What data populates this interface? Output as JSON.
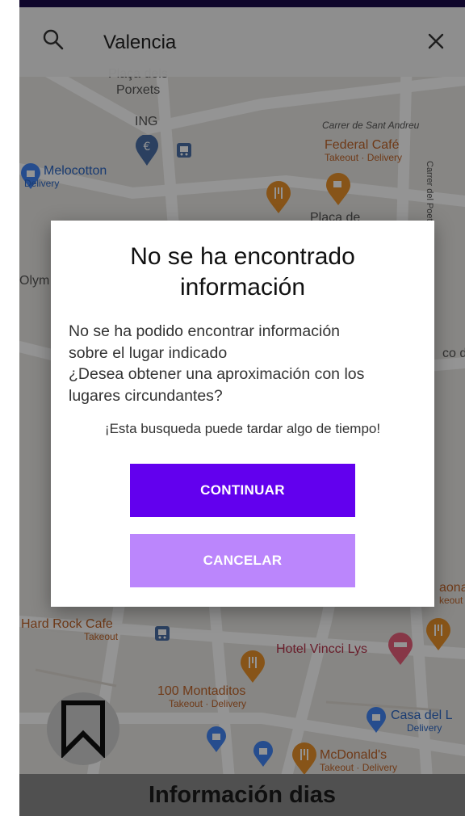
{
  "search": {
    "query": "Valencia"
  },
  "map_labels": {
    "porxets_a": "Plaça dels",
    "porxets_b": "Porxets",
    "ing": "ING",
    "sant_andreu": "Carrer de Sant Andreu",
    "federal_cafe": {
      "name": "Federal Café",
      "sub": "Takeout · Delivery"
    },
    "melocotton": {
      "name": "Melocotton",
      "sub": "Delivery"
    },
    "poeta_querol": "Carrer del Poeta Querol",
    "placa_de": "Plaça de",
    "olym": "Olym",
    "co_de": "co de",
    "aona": {
      "name": "aona",
      "sub": "keout"
    },
    "hard_rock": {
      "name": "Hard Rock Cafe",
      "sub": "Takeout"
    },
    "hotel_vincci": "Hotel Vincci Lys",
    "montaditos": {
      "name": "100 Montaditos",
      "sub": "Takeout · Delivery"
    },
    "casa_del": {
      "name": "Casa del L",
      "sub": "Delivery"
    },
    "mcdonalds": {
      "name": "McDonald's",
      "sub": "Takeout · Delivery"
    }
  },
  "dialog": {
    "title_line1": "No se ha encontrado",
    "title_line2": "información",
    "message_line1": "No se ha podido encontrar información",
    "message_line2": "sobre el lugar indicado",
    "message_line3": "¿Desea obtener una aproximación con los",
    "message_line4": "lugares circundantes?",
    "note": "¡Esta busqueda puede tardar algo de tiempo!",
    "continue_label": "CONTINUAR",
    "cancel_label": "CANCELAR"
  },
  "bottom": {
    "title": "Información dias"
  },
  "icons": {
    "search": "search-icon",
    "close": "close-icon",
    "bookmark": "bookmark-icon",
    "bank": "euro-icon",
    "transit": "bus-icon",
    "restaurant": "fork-knife-icon",
    "cafe": "coffee-icon",
    "shopping": "shopping-bag-icon",
    "hotel": "bed-icon"
  },
  "colors": {
    "primary": "#6200ee",
    "primary_light": "#bb86fc",
    "status_bar": "#1b0b4a",
    "map_bg": "#e9e7e3",
    "pin_food": "#e8922a",
    "pin_shop": "#4285f4",
    "pin_hotel": "#e8607a"
  }
}
